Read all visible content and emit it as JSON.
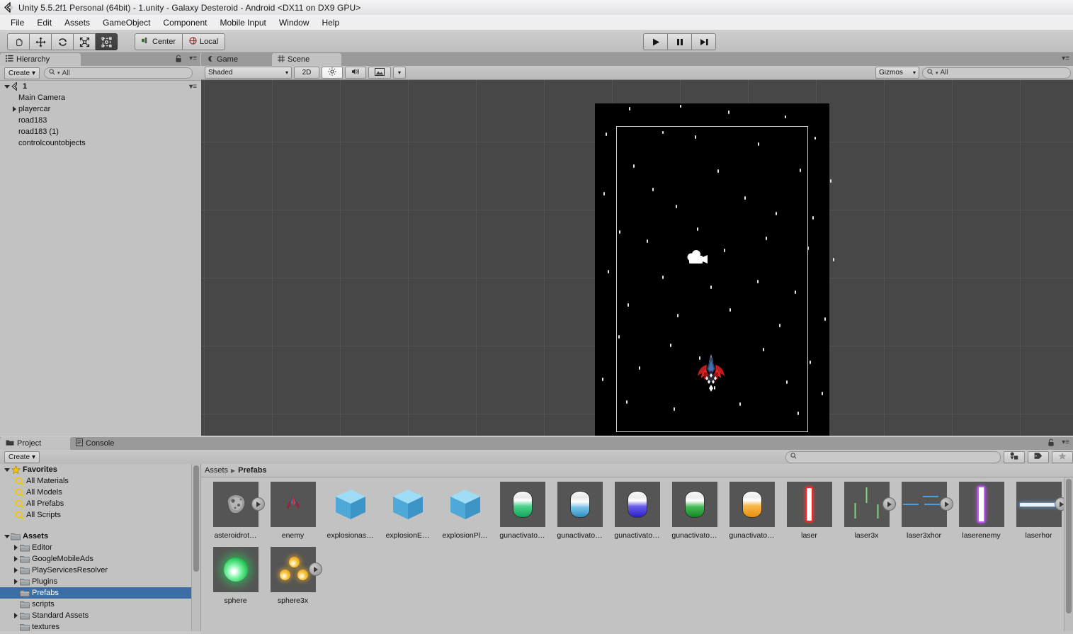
{
  "window": {
    "title": "Unity 5.5.2f1 Personal (64bit) - 1.unity - Galaxy Desteroid - Android <DX11 on DX9 GPU>",
    "logo_icon": "unity-logo-icon"
  },
  "menu": {
    "items": [
      {
        "label": "File"
      },
      {
        "label": "Edit"
      },
      {
        "label": "Assets"
      },
      {
        "label": "GameObject"
      },
      {
        "label": "Component"
      },
      {
        "label": "Mobile Input"
      },
      {
        "label": "Window"
      },
      {
        "label": "Help"
      }
    ]
  },
  "toolbar": {
    "tools": [
      {
        "name": "hand-tool",
        "icon": "hand-icon",
        "active": false
      },
      {
        "name": "move-tool",
        "icon": "move-icon",
        "active": false
      },
      {
        "name": "rotate-tool",
        "icon": "rotate-icon",
        "active": false
      },
      {
        "name": "scale-tool",
        "icon": "scale-icon",
        "active": false
      },
      {
        "name": "rect-tool",
        "icon": "rect-transform-icon",
        "active": true
      }
    ],
    "pivot_label": "Center",
    "space_label": "Local",
    "play_label": "▶",
    "pause_label": "❚❚",
    "step_label": "▶❚"
  },
  "hierarchy": {
    "tab_label": "Hierarchy",
    "create_label": "Create",
    "search_placeholder": "All",
    "scene_name": "1",
    "items": [
      {
        "label": "Main Camera",
        "expandable": false,
        "depth": 1
      },
      {
        "label": "playercar",
        "expandable": true,
        "depth": 1
      },
      {
        "label": "road183",
        "expandable": false,
        "depth": 1
      },
      {
        "label": "road183 (1)",
        "expandable": false,
        "depth": 1
      },
      {
        "label": "controlcountobjects",
        "expandable": false,
        "depth": 1
      }
    ]
  },
  "scene": {
    "tabs": [
      {
        "label": "Game",
        "icon": "game-icon",
        "active": false
      },
      {
        "label": "Scene",
        "icon": "scene-grid-icon",
        "active": true
      }
    ],
    "draw_mode": "Shaded",
    "mode_2d_label": "2D",
    "lighting_icon": "sun-icon",
    "audio_icon": "speaker-icon",
    "effects_icon": "image-icon",
    "gizmos_label": "Gizmos",
    "search_placeholder": "All",
    "objects": [
      {
        "name": "main-camera-gizmo",
        "type": "camera"
      },
      {
        "name": "playercar-sprite",
        "type": "ship"
      }
    ]
  },
  "project": {
    "tabs": [
      {
        "label": "Project",
        "icon": "folder-icon",
        "active": true
      },
      {
        "label": "Console",
        "icon": "console-icon",
        "active": false
      }
    ],
    "create_label": "Create",
    "search_placeholder": "",
    "breadcrumb": [
      "Assets",
      "Prefabs"
    ],
    "tree": [
      {
        "label": "Favorites",
        "icon": "star-icon",
        "depth": 0,
        "arrow": "open",
        "bold": true
      },
      {
        "label": "All Materials",
        "icon": "search-icon",
        "depth": 1,
        "arrow": "none"
      },
      {
        "label": "All Models",
        "icon": "search-icon",
        "depth": 1,
        "arrow": "none"
      },
      {
        "label": "All Prefabs",
        "icon": "search-icon",
        "depth": 1,
        "arrow": "none"
      },
      {
        "label": "All Scripts",
        "icon": "search-icon",
        "depth": 1,
        "arrow": "none"
      },
      {
        "label": "",
        "icon": "none",
        "depth": 0,
        "arrow": "none"
      },
      {
        "label": "Assets",
        "icon": "folder-icon",
        "depth": 0,
        "arrow": "open",
        "bold": true
      },
      {
        "label": "Editor",
        "icon": "folder-icon",
        "depth": 1,
        "arrow": "closed"
      },
      {
        "label": "GoogleMobileAds",
        "icon": "folder-icon",
        "depth": 1,
        "arrow": "closed"
      },
      {
        "label": "PlayServicesResolver",
        "icon": "folder-icon",
        "depth": 1,
        "arrow": "closed"
      },
      {
        "label": "Plugins",
        "icon": "folder-icon",
        "depth": 1,
        "arrow": "closed"
      },
      {
        "label": "Prefabs",
        "icon": "folder-icon",
        "depth": 1,
        "arrow": "none",
        "selected": true
      },
      {
        "label": "scripts",
        "icon": "folder-icon",
        "depth": 1,
        "arrow": "none"
      },
      {
        "label": "Standard Assets",
        "icon": "folder-icon",
        "depth": 1,
        "arrow": "closed"
      },
      {
        "label": "textures",
        "icon": "folder-icon",
        "depth": 1,
        "arrow": "none"
      }
    ],
    "assets": [
      {
        "label": "asteroidrot…",
        "thumb": "asteroid",
        "badge": true
      },
      {
        "label": "enemy",
        "thumb": "enemy-ship",
        "badge": false
      },
      {
        "label": "explosionas…",
        "thumb": "cube",
        "badge": false
      },
      {
        "label": "explosionE…",
        "thumb": "cube",
        "badge": false
      },
      {
        "label": "explosionPl…",
        "thumb": "cube",
        "badge": false
      },
      {
        "label": "gunactivato…",
        "thumb": "capsule-green",
        "badge": false
      },
      {
        "label": "gunactivato…",
        "thumb": "capsule-blue",
        "badge": false
      },
      {
        "label": "gunactivato…",
        "thumb": "capsule-purple",
        "badge": false
      },
      {
        "label": "gunactivato…",
        "thumb": "capsule-green2",
        "badge": false
      },
      {
        "label": "gunactivato…",
        "thumb": "capsule-orange",
        "badge": false
      },
      {
        "label": "laser",
        "thumb": "laser-red",
        "badge": false
      },
      {
        "label": "laser3x",
        "thumb": "laser-3x-green",
        "badge": true
      },
      {
        "label": "laser3xhor",
        "thumb": "laser-3x-hor-blue",
        "badge": true
      },
      {
        "label": "laserenemy",
        "thumb": "laser-purple",
        "badge": false
      },
      {
        "label": "laserhor",
        "thumb": "laser-hor-blue",
        "badge": true
      },
      {
        "label": "sphere",
        "thumb": "sphere-green",
        "badge": false
      },
      {
        "label": "sphere3x",
        "thumb": "sphere-3x-orange",
        "badge": true
      }
    ],
    "filter_type_icon": "filter-by-type-icon",
    "filter_label_icon": "filter-by-label-icon",
    "favorite_icon": "star-icon"
  },
  "colors": {
    "selection_blue": "#3a6ea5",
    "panel_gray": "#c2c2c2",
    "scene_bg": "#474747",
    "game_bg": "#000000",
    "laser_red": "#ff2d2d",
    "laser_green": "#6fcf6f",
    "laser_blue": "#4a90e2",
    "laser_purple": "#c45cff",
    "sphere_green": "#2fd45f",
    "sphere_orange": "#f0a81e"
  }
}
